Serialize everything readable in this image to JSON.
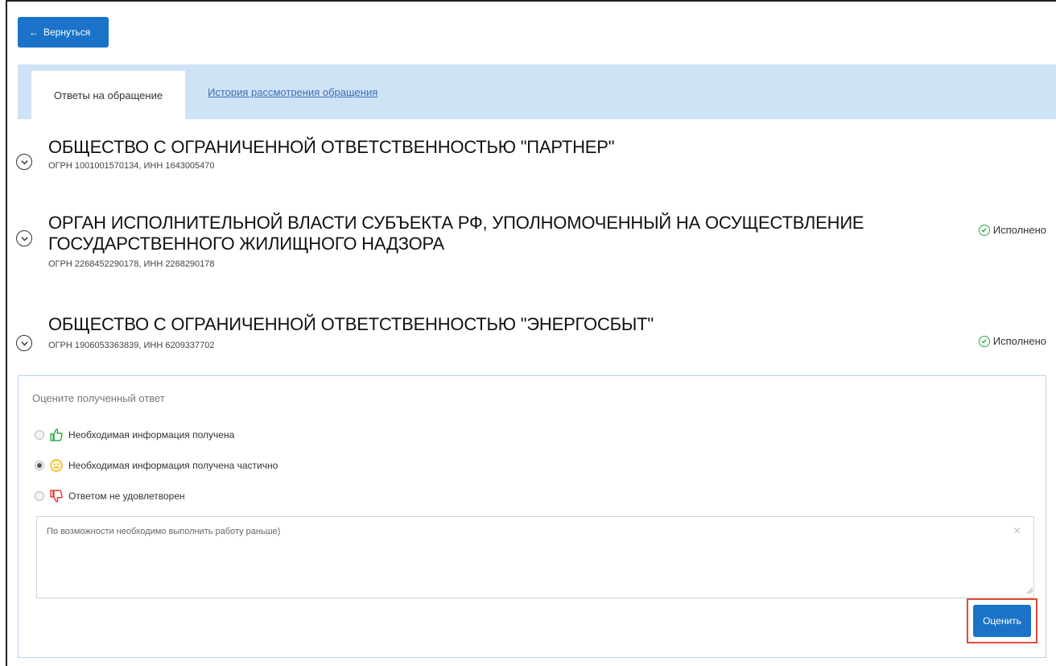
{
  "header": {
    "back_label": "Вернуться"
  },
  "tabs": [
    {
      "label": "Ответы на обращение",
      "active": true
    },
    {
      "label": "История рассмотрения обращения",
      "active": false
    }
  ],
  "organizations": [
    {
      "title_lines": [
        "ОБЩЕСТВО С ОГРАНИЧЕННОЙ ОТВЕТСТВЕННОСТЬЮ \"ПАРТНЕР\""
      ],
      "details": "ОГРН 1001001570134, ИНН 1643005470",
      "status": ""
    },
    {
      "title_lines": [
        "ОРГАН ИСПОЛНИТЕЛЬНОЙ ВЛАСТИ СУБЪЕКТА РФ, УПОЛНОМОЧЕННЫЙ НА ОСУЩЕСТВЛЕНИЕ",
        "ГОСУДАРСТВЕННОГО ЖИЛИЩНОГО НАДЗОРА"
      ],
      "details": "ОГРН 2268452290178, ИНН 2268290178",
      "status": "Исполнено"
    },
    {
      "title_lines": [
        "ОБЩЕСТВО С ОГРАНИЧЕННОЙ ОТВЕТСТВЕННОСТЬЮ \"ЭНЕРГОСБЫТ\""
      ],
      "details": "ОГРН 1906053363839, ИНН 6209337702",
      "status": "Исполнено"
    }
  ],
  "rating": {
    "label": "Оцените полученный ответ",
    "options": [
      {
        "label": "Необходимая информация получена",
        "icon": "thumbs-up-icon",
        "selected": false
      },
      {
        "label": "Необходимая информация получена частично",
        "icon": "neutral-face-icon",
        "selected": true
      },
      {
        "label": "Ответом не удовлетворен",
        "icon": "thumbs-down-icon",
        "selected": false
      }
    ],
    "comment": "По возможности необходимо выполнить работу раньше)",
    "submit_label": "Оценить"
  },
  "colors": {
    "accent": "#1a73c8",
    "tab_bar": "#cfe3f6",
    "ok": "#2da64a",
    "highlight": "#e04a33"
  }
}
